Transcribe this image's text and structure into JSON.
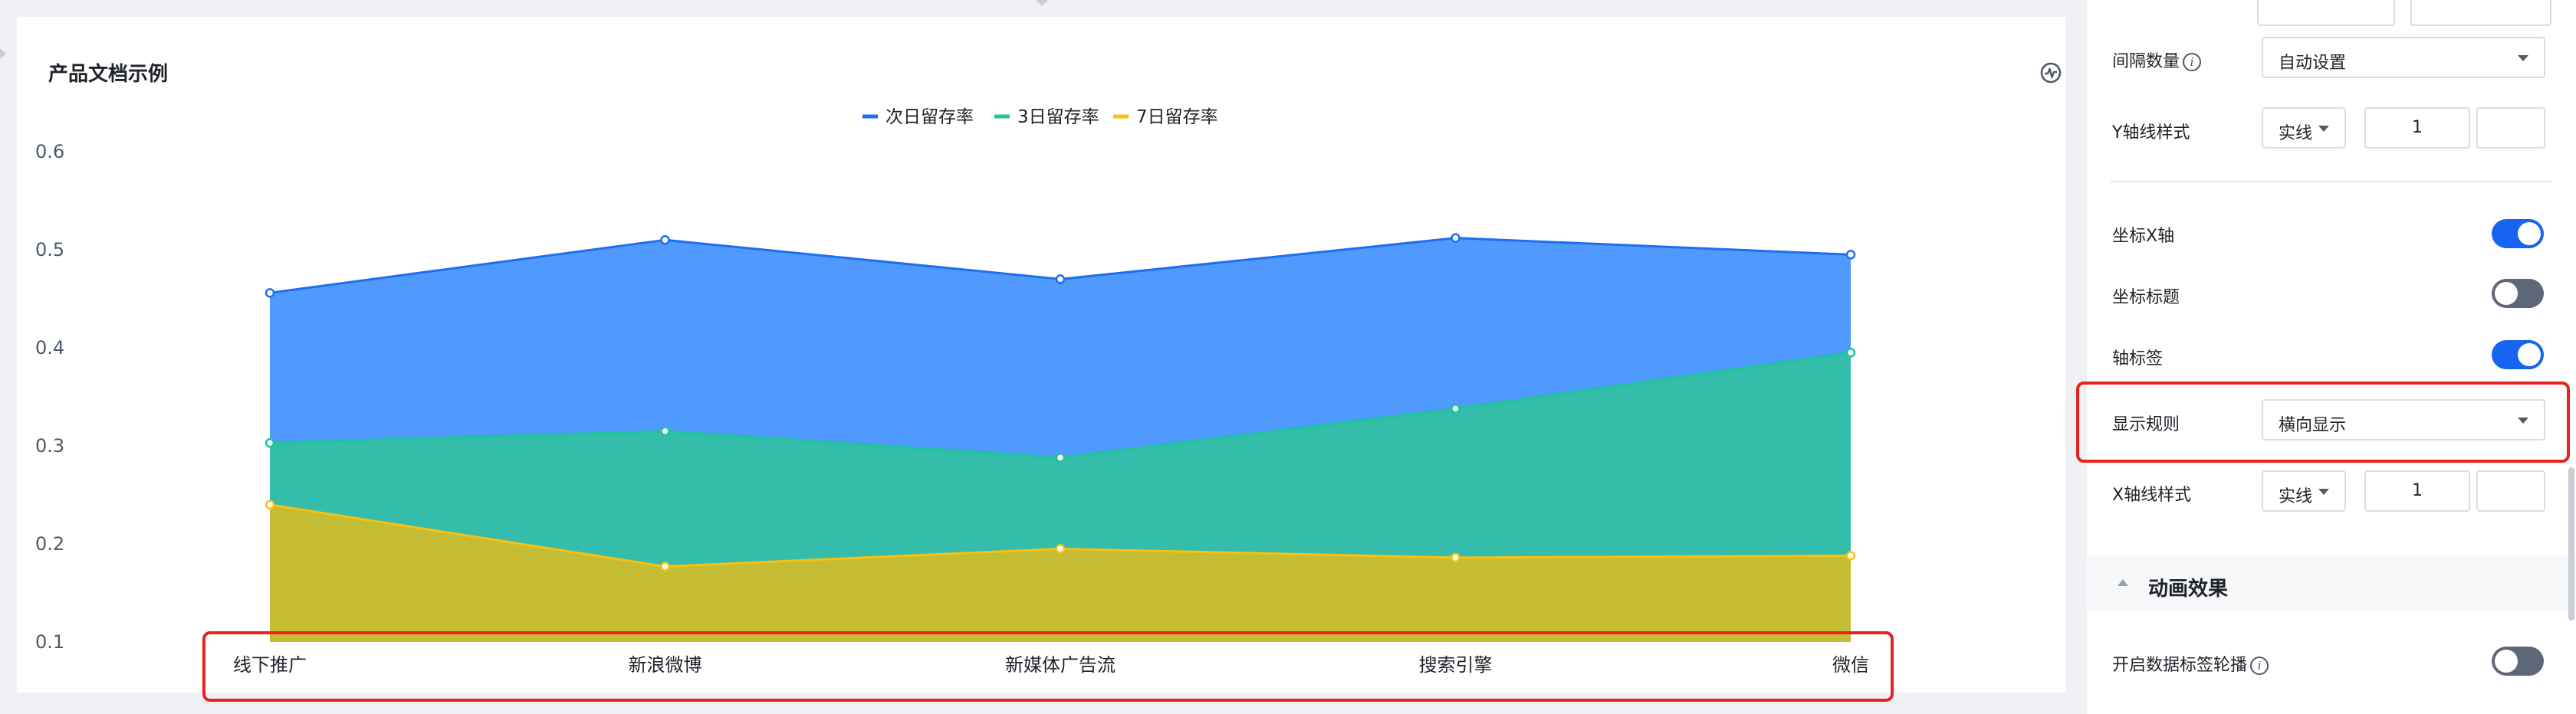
{
  "chart": {
    "title": "产品文档示例",
    "action_icon": "pulse-icon",
    "colors": {
      "series1": "#1d6ff2",
      "series2": "#1ec498",
      "series3": "#fcc010"
    }
  },
  "chart_data": {
    "type": "area",
    "categories": [
      "线下推广",
      "新浪微博",
      "新媒体广告流",
      "搜索引擎",
      "微信"
    ],
    "series": [
      {
        "name": "次日留存率",
        "values": [
          0.456,
          0.51,
          0.47,
          0.512,
          0.495
        ]
      },
      {
        "name": "3日留存率",
        "values": [
          0.303,
          0.315,
          0.288,
          0.338,
          0.395
        ]
      },
      {
        "name": "7日留存率",
        "values": [
          0.24,
          0.177,
          0.195,
          0.186,
          0.188
        ]
      }
    ],
    "ylim": [
      0.1,
      0.6
    ],
    "yticks": [
      "0.1",
      "0.2",
      "0.3",
      "0.4",
      "0.5",
      "0.6"
    ],
    "title": "",
    "xlabel": "",
    "ylabel": "",
    "legend": "top-center",
    "grid": false
  },
  "panel": {
    "interval_label": "间隔数量",
    "interval_value": "自动设置",
    "y_line_label": "Y轴线样式",
    "y_line_style": "实线",
    "y_line_width": "1",
    "x_axis_label": "坐标X轴",
    "x_axis_on": true,
    "axis_title_label": "坐标标题",
    "axis_title_on": false,
    "axis_tick_label": "轴标签",
    "axis_tick_on": true,
    "display_rule_label": "显示规则",
    "display_rule_value": "横向显示",
    "x_line_label": "X轴线样式",
    "x_line_style": "实线",
    "x_line_width": "1",
    "anim_section": "动画效果",
    "carousel_label": "开启数据标签轮播",
    "carousel_on": false,
    "info_glyph": "i"
  },
  "highlight_color": "#e8231e"
}
